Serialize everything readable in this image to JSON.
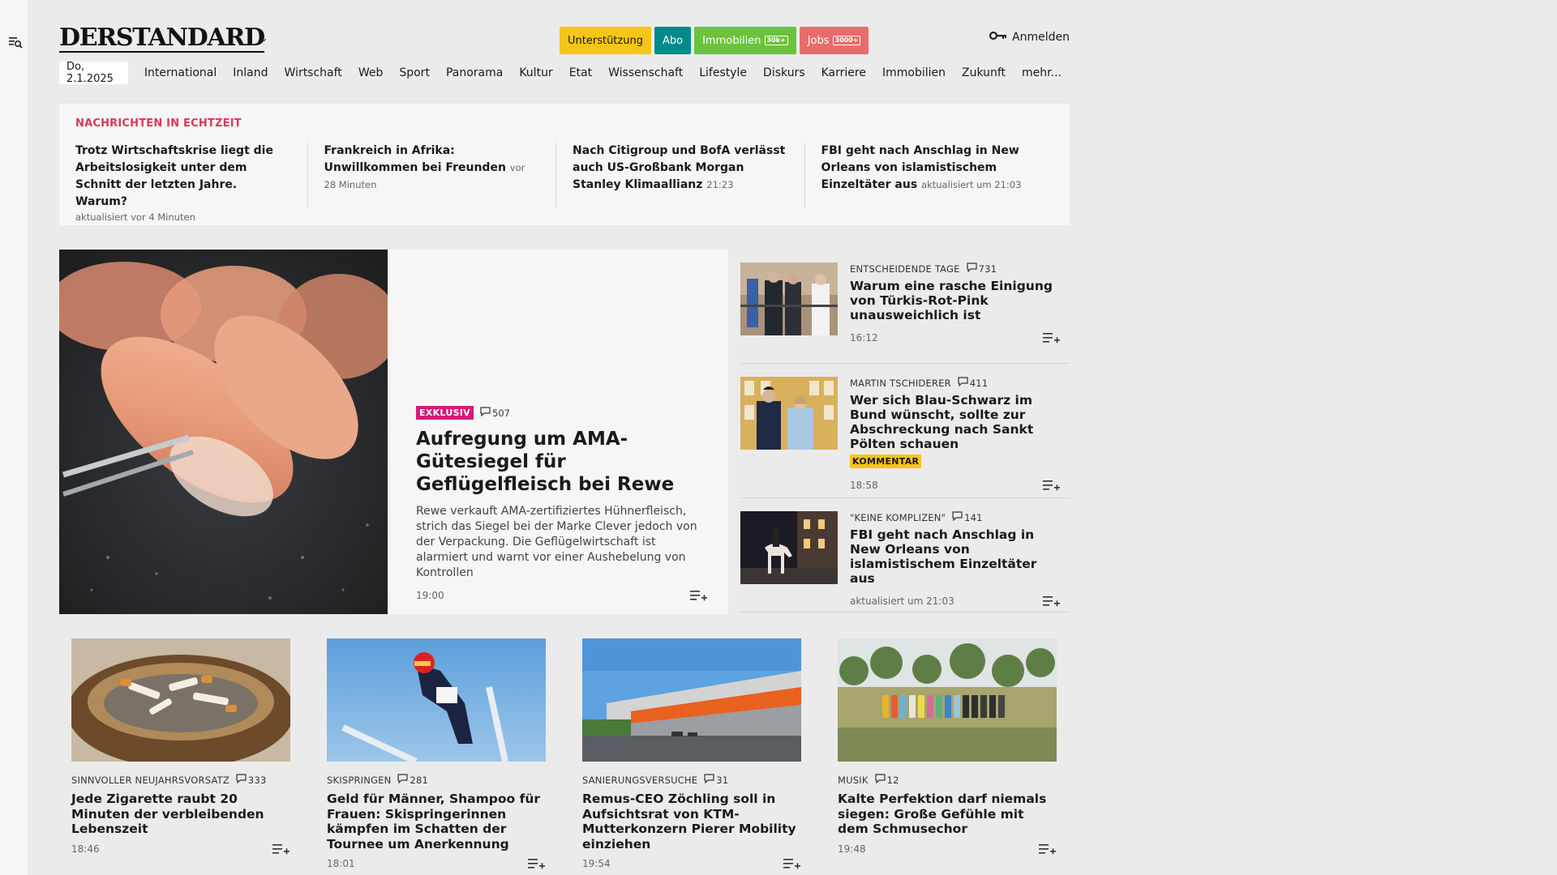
{
  "sidebar": {
    "menu_icon": "menu-search-icon"
  },
  "header": {
    "logo": "DERSTANDARD",
    "buttons": {
      "support": "Unterstützung",
      "abo": "Abo",
      "immobilien": "Immobilien",
      "immobilien_count": "30k+",
      "jobs": "Jobs",
      "jobs_count": "3000+"
    },
    "login": "Anmelden",
    "login_icon": "key-icon",
    "date": "Do, 2.1.2025",
    "nav": [
      "International",
      "Inland",
      "Wirtschaft",
      "Web",
      "Sport",
      "Panorama",
      "Kultur",
      "Etat",
      "Wissenschaft",
      "Lifestyle",
      "Diskurs",
      "Karriere",
      "Immobilien",
      "Zukunft",
      "mehr..."
    ]
  },
  "colors": {
    "support": "#f5c518",
    "abo": "#00898a",
    "immobilien": "#6cc23a",
    "jobs": "#ea6b6b",
    "live_label": "#d93a55",
    "exklusiv": "#d6197a",
    "kommentar": "#f5c518"
  },
  "ticker": {
    "label": "NACHRICHTEN IN ECHTZEIT",
    "items": [
      {
        "title": "Trotz Wirtschaftskrise liegt die Ar­beitslosigkeit unter dem Schnitt der letzten Jahre. Warum?",
        "meta": "aktualisiert vor 4 Minuten"
      },
      {
        "title": "Frankreich in Afrika: Unwillkommen bei Freunden",
        "meta": "vor 28 Minuten"
      },
      {
        "title": "Nach Citigroup und BofA verlässt auch US-Großbank Morgan Stanley Klimaallianz",
        "meta": "21:23"
      },
      {
        "title": "FBI geht nach Anschlag in New Or­leans von islamistischem Einzeltäter aus",
        "meta": "aktualisiert um 21:03"
      }
    ]
  },
  "hero": {
    "badge": "EXKLUSIV",
    "comments": "507",
    "title": "Aufregung um AMA-Gütesiegel für Geflügelfleisch bei Rewe",
    "lead": "Rewe verkauft AMA-zertifiziertes Hühnerfleisch, strich das Siegel bei der Marke Clever jedoch von der Verpackung. Die Geflügelwirtschaft ist alarmiert und warnt vor einer Aushebelung von Kontrollen",
    "time": "19:00"
  },
  "side": [
    {
      "kicker": "ENTSCHEIDENDE TAGE",
      "comments": "731",
      "title": "Warum eine rasche Einigung von Türkis-Rot-Pink unausweichlich ist",
      "badge": "",
      "time": "16:12"
    },
    {
      "kicker": "MARTIN TSCHIDERER",
      "comments": "411",
      "title": "Wer sich Blau-Schwarz im Bund wünscht, sollte zur Abschreckung nach Sankt Pölten schauen",
      "badge": "KOMMENTAR",
      "time": "18:58"
    },
    {
      "kicker": "\"KEINE KOMPLIZEN\"",
      "comments": "141",
      "title": "FBI geht nach Anschlag in New Orleans von islamistischem Einzeltäter aus",
      "badge": "",
      "time": "aktualisiert um 21:03"
    }
  ],
  "cards": [
    {
      "kicker": "SINNVOLLER NEUJAHRSVORSATZ",
      "comments": "333",
      "title": "Jede Zigarette raubt 20 Minuten der verbleibenden Lebenszeit",
      "time": "18:46"
    },
    {
      "kicker": "SKISPRINGEN",
      "comments": "281",
      "title": "Geld für Männer, Shampoo für Frauen: Skispringerinnen kämpfen im Schatten der Tournee um Anerkennung",
      "time": "18:01"
    },
    {
      "kicker": "SANIERUNGSVERSUCHE",
      "comments": "31",
      "title": "Remus-CEO Zöchling soll in Aufsichtsrat von KTM-Mutterkon­zern Pierer Mobility einziehen",
      "time": "19:54"
    },
    {
      "kicker": "MUSIK",
      "comments": "12",
      "title": "Kalte Perfektion darf niemals siegen: Große Gefühle mit dem Schmusechor",
      "time": "19:48"
    }
  ]
}
